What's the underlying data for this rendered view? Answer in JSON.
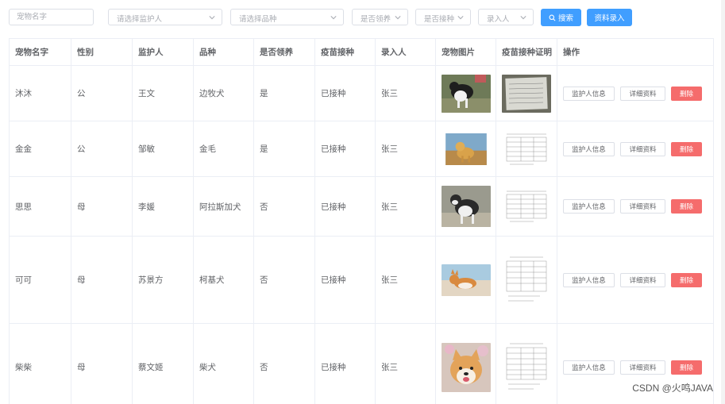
{
  "filters": {
    "pet_name_placeholder": "宠物名字",
    "guardian_placeholder": "请选择监护人",
    "breed_placeholder": "请选择品种",
    "adopt_placeholder": "是否领养",
    "vaccine_placeholder": "是否接种",
    "recorder_placeholder": "录入人",
    "search_label": "搜索",
    "create_label": "资料录入"
  },
  "table": {
    "headers": [
      "宠物名字",
      "性别",
      "监护人",
      "品种",
      "是否领养",
      "疫苗接种",
      "录入人",
      "宠物图片",
      "疫苗接种证明",
      "操作"
    ],
    "rows": [
      {
        "name": "沐沐",
        "gender": "公",
        "guardian": "王文",
        "breed": "边牧犬",
        "adopted": "是",
        "vaccine": "已接种",
        "recorder": "张三"
      },
      {
        "name": "金金",
        "gender": "公",
        "guardian": "邹敏",
        "breed": "金毛",
        "adopted": "是",
        "vaccine": "已接种",
        "recorder": "张三"
      },
      {
        "name": "思思",
        "gender": "母",
        "guardian": "李媛",
        "breed": "阿拉斯加犬",
        "adopted": "否",
        "vaccine": "已接种",
        "recorder": "张三"
      },
      {
        "name": "可可",
        "gender": "母",
        "guardian": "苏景方",
        "breed": "柯基犬",
        "adopted": "否",
        "vaccine": "已接种",
        "recorder": "张三"
      },
      {
        "name": "柴柴",
        "gender": "母",
        "guardian": "蔡文姬",
        "breed": "柴犬",
        "adopted": "否",
        "vaccine": "已接种",
        "recorder": "张三"
      }
    ],
    "actions": {
      "guardian_info": "监护人信息",
      "details": "详细资料",
      "delete": "删除"
    }
  },
  "colors": {
    "primary": "#409eff",
    "danger": "#f56c6c",
    "border": "#ebeef5"
  },
  "watermark": "CSDN @火鸣JAVA"
}
